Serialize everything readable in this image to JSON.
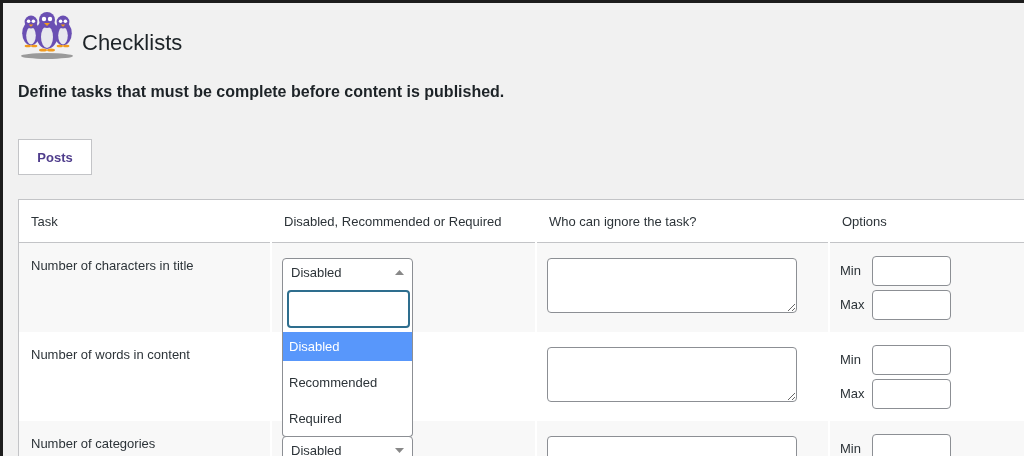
{
  "page": {
    "title": "Checklists",
    "description": "Define tasks that must be complete before content is published."
  },
  "tabs": [
    {
      "label": "Posts",
      "selected": true
    }
  ],
  "table": {
    "columns": [
      "Task",
      "Disabled, Recommended or Required",
      "Who can ignore the task?",
      "Options"
    ],
    "rows": [
      {
        "task": "Number of characters in title",
        "status": {
          "value": "Disabled",
          "expanded": true
        },
        "options": [
          "Min",
          "Max"
        ]
      },
      {
        "task": "Number of words in content",
        "options": [
          "Min",
          "Max"
        ]
      },
      {
        "task": "Number of categories",
        "status": {
          "value": "Disabled",
          "expanded": false
        },
        "options": [
          "Min"
        ]
      }
    ]
  },
  "dropdown": {
    "options": [
      {
        "label": "Disabled",
        "selected": true
      },
      {
        "label": "Recommended",
        "selected": false
      },
      {
        "label": "Required",
        "selected": false
      }
    ]
  }
}
